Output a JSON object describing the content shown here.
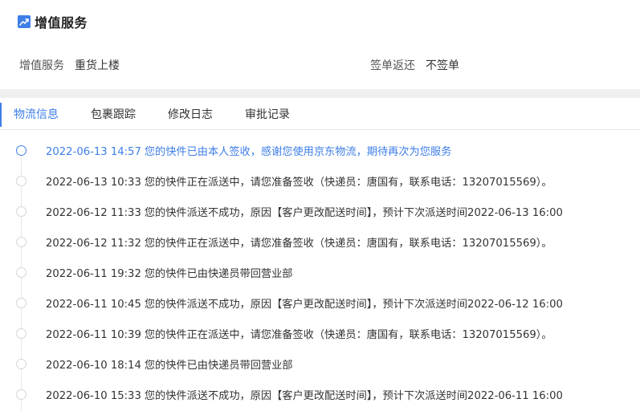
{
  "section": {
    "icon": "trend-chart-icon",
    "title": "增值服务"
  },
  "info": {
    "service_label": "增值服务",
    "service_value": "重货上楼",
    "return_label": "签单返还",
    "return_value": "不签单"
  },
  "tabs": [
    {
      "label": "物流信息",
      "active": true
    },
    {
      "label": "包裹跟踪",
      "active": false
    },
    {
      "label": "修改日志",
      "active": false
    },
    {
      "label": "审批记录",
      "active": false
    }
  ],
  "timeline": [
    {
      "time": "2022-06-13 14:57",
      "text": "您的快件已由本人签收，感谢您使用京东物流，期待再次为您服务",
      "active": true
    },
    {
      "time": "2022-06-13 10:33",
      "text": "您的快件正在派送中，请您准备签收（快递员：唐国有，联系电话：13207015569）。",
      "active": false
    },
    {
      "time": "2022-06-12 11:33",
      "text": "您的快件派送不成功，原因【客户更改配送时间】，预计下次派送时间2022-06-13 16:00",
      "active": false
    },
    {
      "time": "2022-06-12 11:32",
      "text": "您的快件正在派送中，请您准备签收（快递员：唐国有，联系电话：13207015569）。",
      "active": false
    },
    {
      "time": "2022-06-11 19:32",
      "text": "您的快件已由快递员带回营业部",
      "active": false
    },
    {
      "time": "2022-06-11 10:45",
      "text": "您的快件派送不成功，原因【客户更改配送时间】，预计下次派送时间2022-06-12 16:00",
      "active": false
    },
    {
      "time": "2022-06-11 10:39",
      "text": "您的快件正在派送中，请您准备签收（快递员：唐国有，联系电话：13207015569）。",
      "active": false
    },
    {
      "time": "2022-06-10 18:14",
      "text": "您的快件已由快递员带回营业部",
      "active": false
    },
    {
      "time": "2022-06-10 15:33",
      "text": "您的快件派送不成功，原因【客户更改配送时间】，预计下次派送时间2022-06-11 16:00",
      "active": false
    }
  ],
  "colors": {
    "accent": "#3e7ee8",
    "band": "#efefef"
  }
}
